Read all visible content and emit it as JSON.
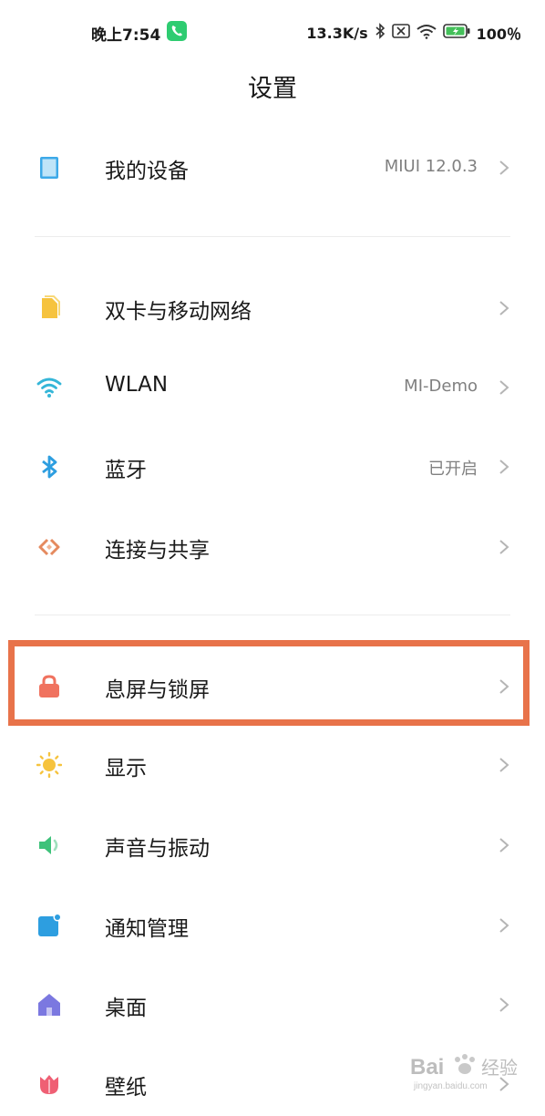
{
  "status_bar": {
    "time": "晚上7:54",
    "net_speed": "13.3K/s",
    "battery_percent": "100％"
  },
  "page": {
    "title": "设置"
  },
  "rows": [
    {
      "label": "我的设备",
      "value": "MIUI 12.0.3",
      "icon": "tablet-icon",
      "icon_color": "#3da9e8"
    },
    {
      "label": "双卡与移动网络",
      "value": "",
      "icon": "sim-card-icon",
      "icon_color": "#f6c33e"
    },
    {
      "label": "WLAN",
      "value": "MI-Demo",
      "icon": "wifi-icon",
      "icon_color": "#35b6d8"
    },
    {
      "label": "蓝牙",
      "value": "已开启",
      "icon": "bluetooth-icon",
      "icon_color": "#2d9ee0"
    },
    {
      "label": "连接与共享",
      "value": "",
      "icon": "connection-sharing-icon",
      "icon_color": "#e58a5f"
    },
    {
      "label": "息屏与锁屏",
      "value": "",
      "icon": "lock-icon",
      "icon_color": "#f0725f"
    },
    {
      "label": "显示",
      "value": "",
      "icon": "sun-icon",
      "icon_color": "#f6c33e"
    },
    {
      "label": "声音与振动",
      "value": "",
      "icon": "speaker-icon",
      "icon_color": "#3ec27a"
    },
    {
      "label": "通知管理",
      "value": "",
      "icon": "notification-icon",
      "icon_color": "#2d9ee0"
    },
    {
      "label": "桌面",
      "value": "",
      "icon": "home-icon",
      "icon_color": "#7b78e0"
    },
    {
      "label": "壁纸",
      "value": "",
      "icon": "tulip-icon",
      "icon_color": "#ef5f74"
    }
  ],
  "highlight": {
    "color": "#e8734a",
    "target_row": "息屏与锁屏"
  },
  "watermark": {
    "text": "Bai 经验",
    "subtext": "jingyan.baidu.com"
  }
}
